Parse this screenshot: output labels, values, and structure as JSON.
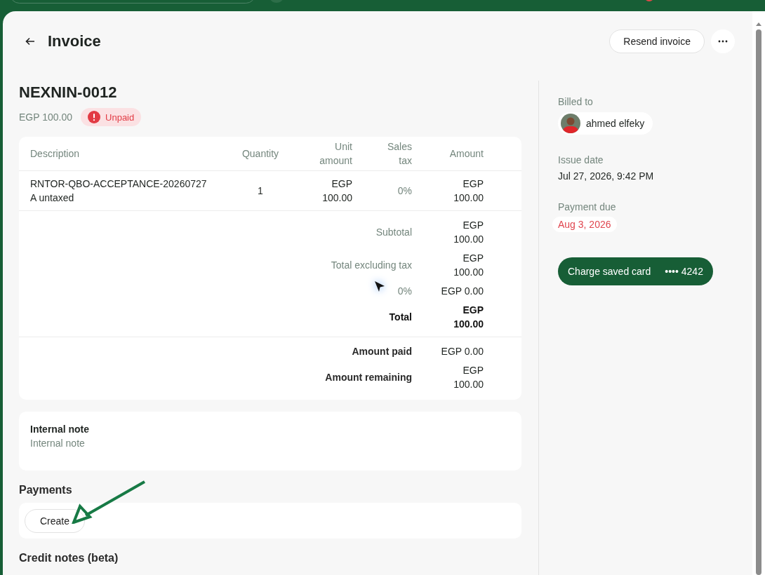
{
  "header": {
    "title": "Invoice",
    "resend_button": "Resend invoice"
  },
  "invoice": {
    "number": "NEXNIN-0012",
    "total": "EGP 100.00",
    "status": {
      "kind": "unpaid",
      "label": "Unpaid"
    }
  },
  "line_items": {
    "columns": [
      "Description",
      "Quantity",
      "Unit amount",
      "Sales tax",
      "Amount"
    ],
    "rows": [
      {
        "description": "RNTOR-QBO-ACCEPTANCE-20260727\nA untaxed",
        "quantity": "1",
        "unit_amount": "EGP 100.00",
        "sales_tax": "0%",
        "amount": "EGP 100.00"
      }
    ]
  },
  "summary": [
    {
      "label": "Subtotal",
      "value": "EGP 100.00",
      "kind": "muted"
    },
    {
      "label": "Total excluding tax",
      "value": "EGP 100.00",
      "kind": "muted"
    },
    {
      "label": "0%",
      "value": "EGP 0.00",
      "kind": "muted"
    },
    {
      "label": "Total",
      "value": "EGP 100.00",
      "kind": "total"
    }
  ],
  "balance": [
    {
      "label": "Amount paid",
      "value": "EGP 0.00"
    },
    {
      "label": "Amount remaining",
      "value": "EGP 100.00"
    }
  ],
  "internal_note": {
    "label": "Internal note",
    "placeholder": "Internal note"
  },
  "payments": {
    "heading": "Payments",
    "create_button": "Create"
  },
  "credit_notes": {
    "heading": "Credit notes (beta)"
  },
  "details": {
    "billed_to": {
      "label": "Billed to",
      "customer": "ahmed elfeky"
    },
    "issue_date": {
      "label": "Issue date",
      "value": "Jul 27, 2026, 9:42 PM"
    },
    "payment_due": {
      "label": "Payment due",
      "value": "Aug 3, 2026",
      "overdue": true
    }
  },
  "charge_button": {
    "label": "Charge saved card",
    "card": "•••• 4242"
  }
}
